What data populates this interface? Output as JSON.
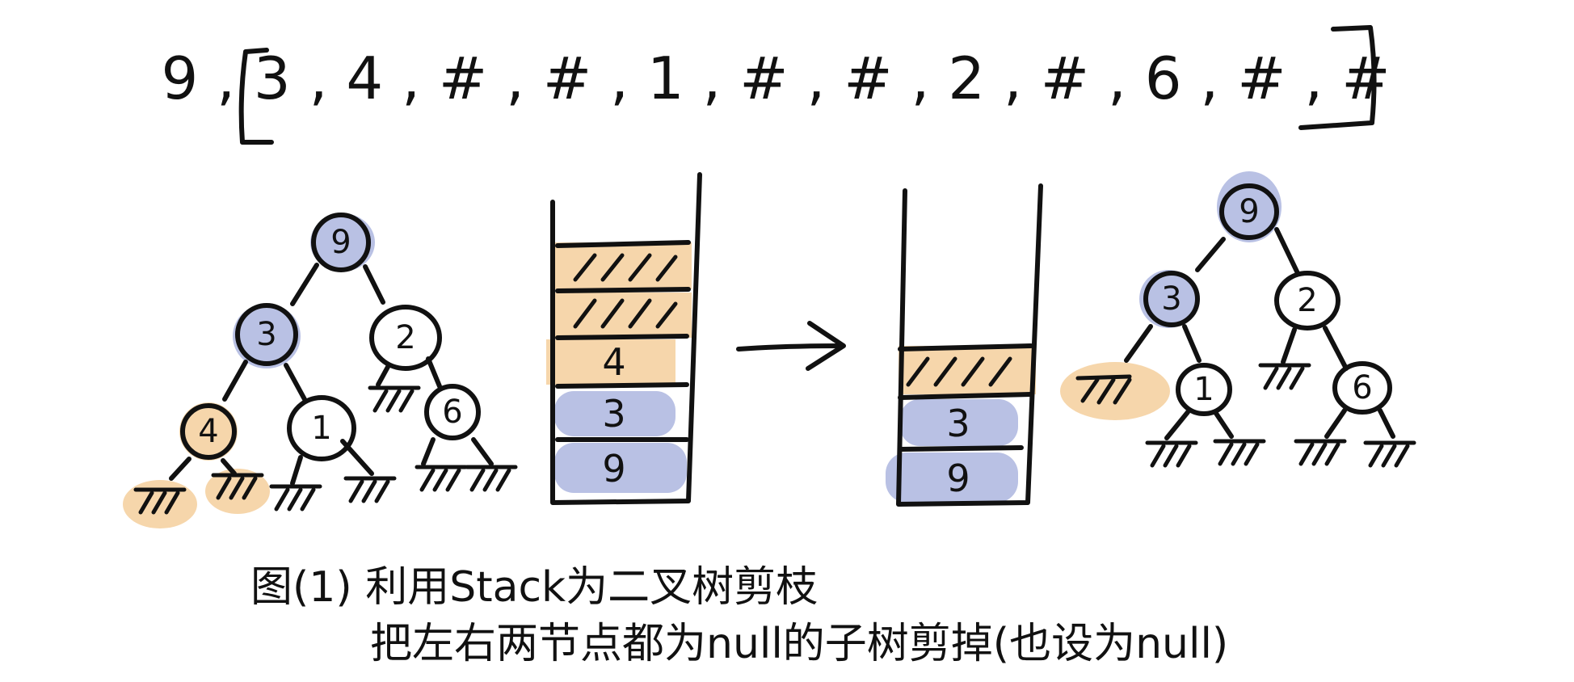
{
  "serialization": {
    "open_bracket": "[",
    "close_bracket": "]",
    "items": [
      "9",
      "3",
      "4",
      "#",
      "#",
      "1",
      "#",
      "#",
      "2",
      "#",
      "6",
      "#",
      "#"
    ],
    "separator": ","
  },
  "colors": {
    "visited_highlight": "#b9c1e4",
    "null_highlight": "#f6d6ab",
    "ink": "#111111"
  },
  "icons": {
    "null_leaf": "hatched-null-icon",
    "arrow": "right-arrow-icon"
  },
  "tree_before": {
    "nodes": [
      {
        "id": "n9",
        "label": "9",
        "highlight": "visited"
      },
      {
        "id": "n3",
        "label": "3",
        "highlight": "visited"
      },
      {
        "id": "n2",
        "label": "2",
        "highlight": "none"
      },
      {
        "id": "n4",
        "label": "4",
        "highlight": "null"
      },
      {
        "id": "n1",
        "label": "1",
        "highlight": "none"
      },
      {
        "id": "n6",
        "label": "6",
        "highlight": "none"
      }
    ]
  },
  "stack_before": {
    "slots_top_to_bottom": [
      {
        "label": "",
        "kind": "null"
      },
      {
        "label": "",
        "kind": "null"
      },
      {
        "label": "4",
        "kind": "null"
      },
      {
        "label": "3",
        "kind": "visited"
      },
      {
        "label": "9",
        "kind": "visited"
      }
    ]
  },
  "stack_after": {
    "slots_top_to_bottom": [
      {
        "label": "",
        "kind": "null"
      },
      {
        "label": "3",
        "kind": "visited"
      },
      {
        "label": "9",
        "kind": "visited"
      }
    ]
  },
  "tree_after": {
    "nodes": [
      {
        "id": "m9",
        "label": "9",
        "highlight": "visited"
      },
      {
        "id": "m3",
        "label": "3",
        "highlight": "visited"
      },
      {
        "id": "m2",
        "label": "2",
        "highlight": "none"
      },
      {
        "id": "m1",
        "label": "1",
        "highlight": "none"
      },
      {
        "id": "m6",
        "label": "6",
        "highlight": "none"
      }
    ]
  },
  "caption": {
    "line1": "图(1) 利用Stack为二叉树剪枝",
    "line2": "把左右两节点都为null的子树剪掉(也设为null)"
  }
}
